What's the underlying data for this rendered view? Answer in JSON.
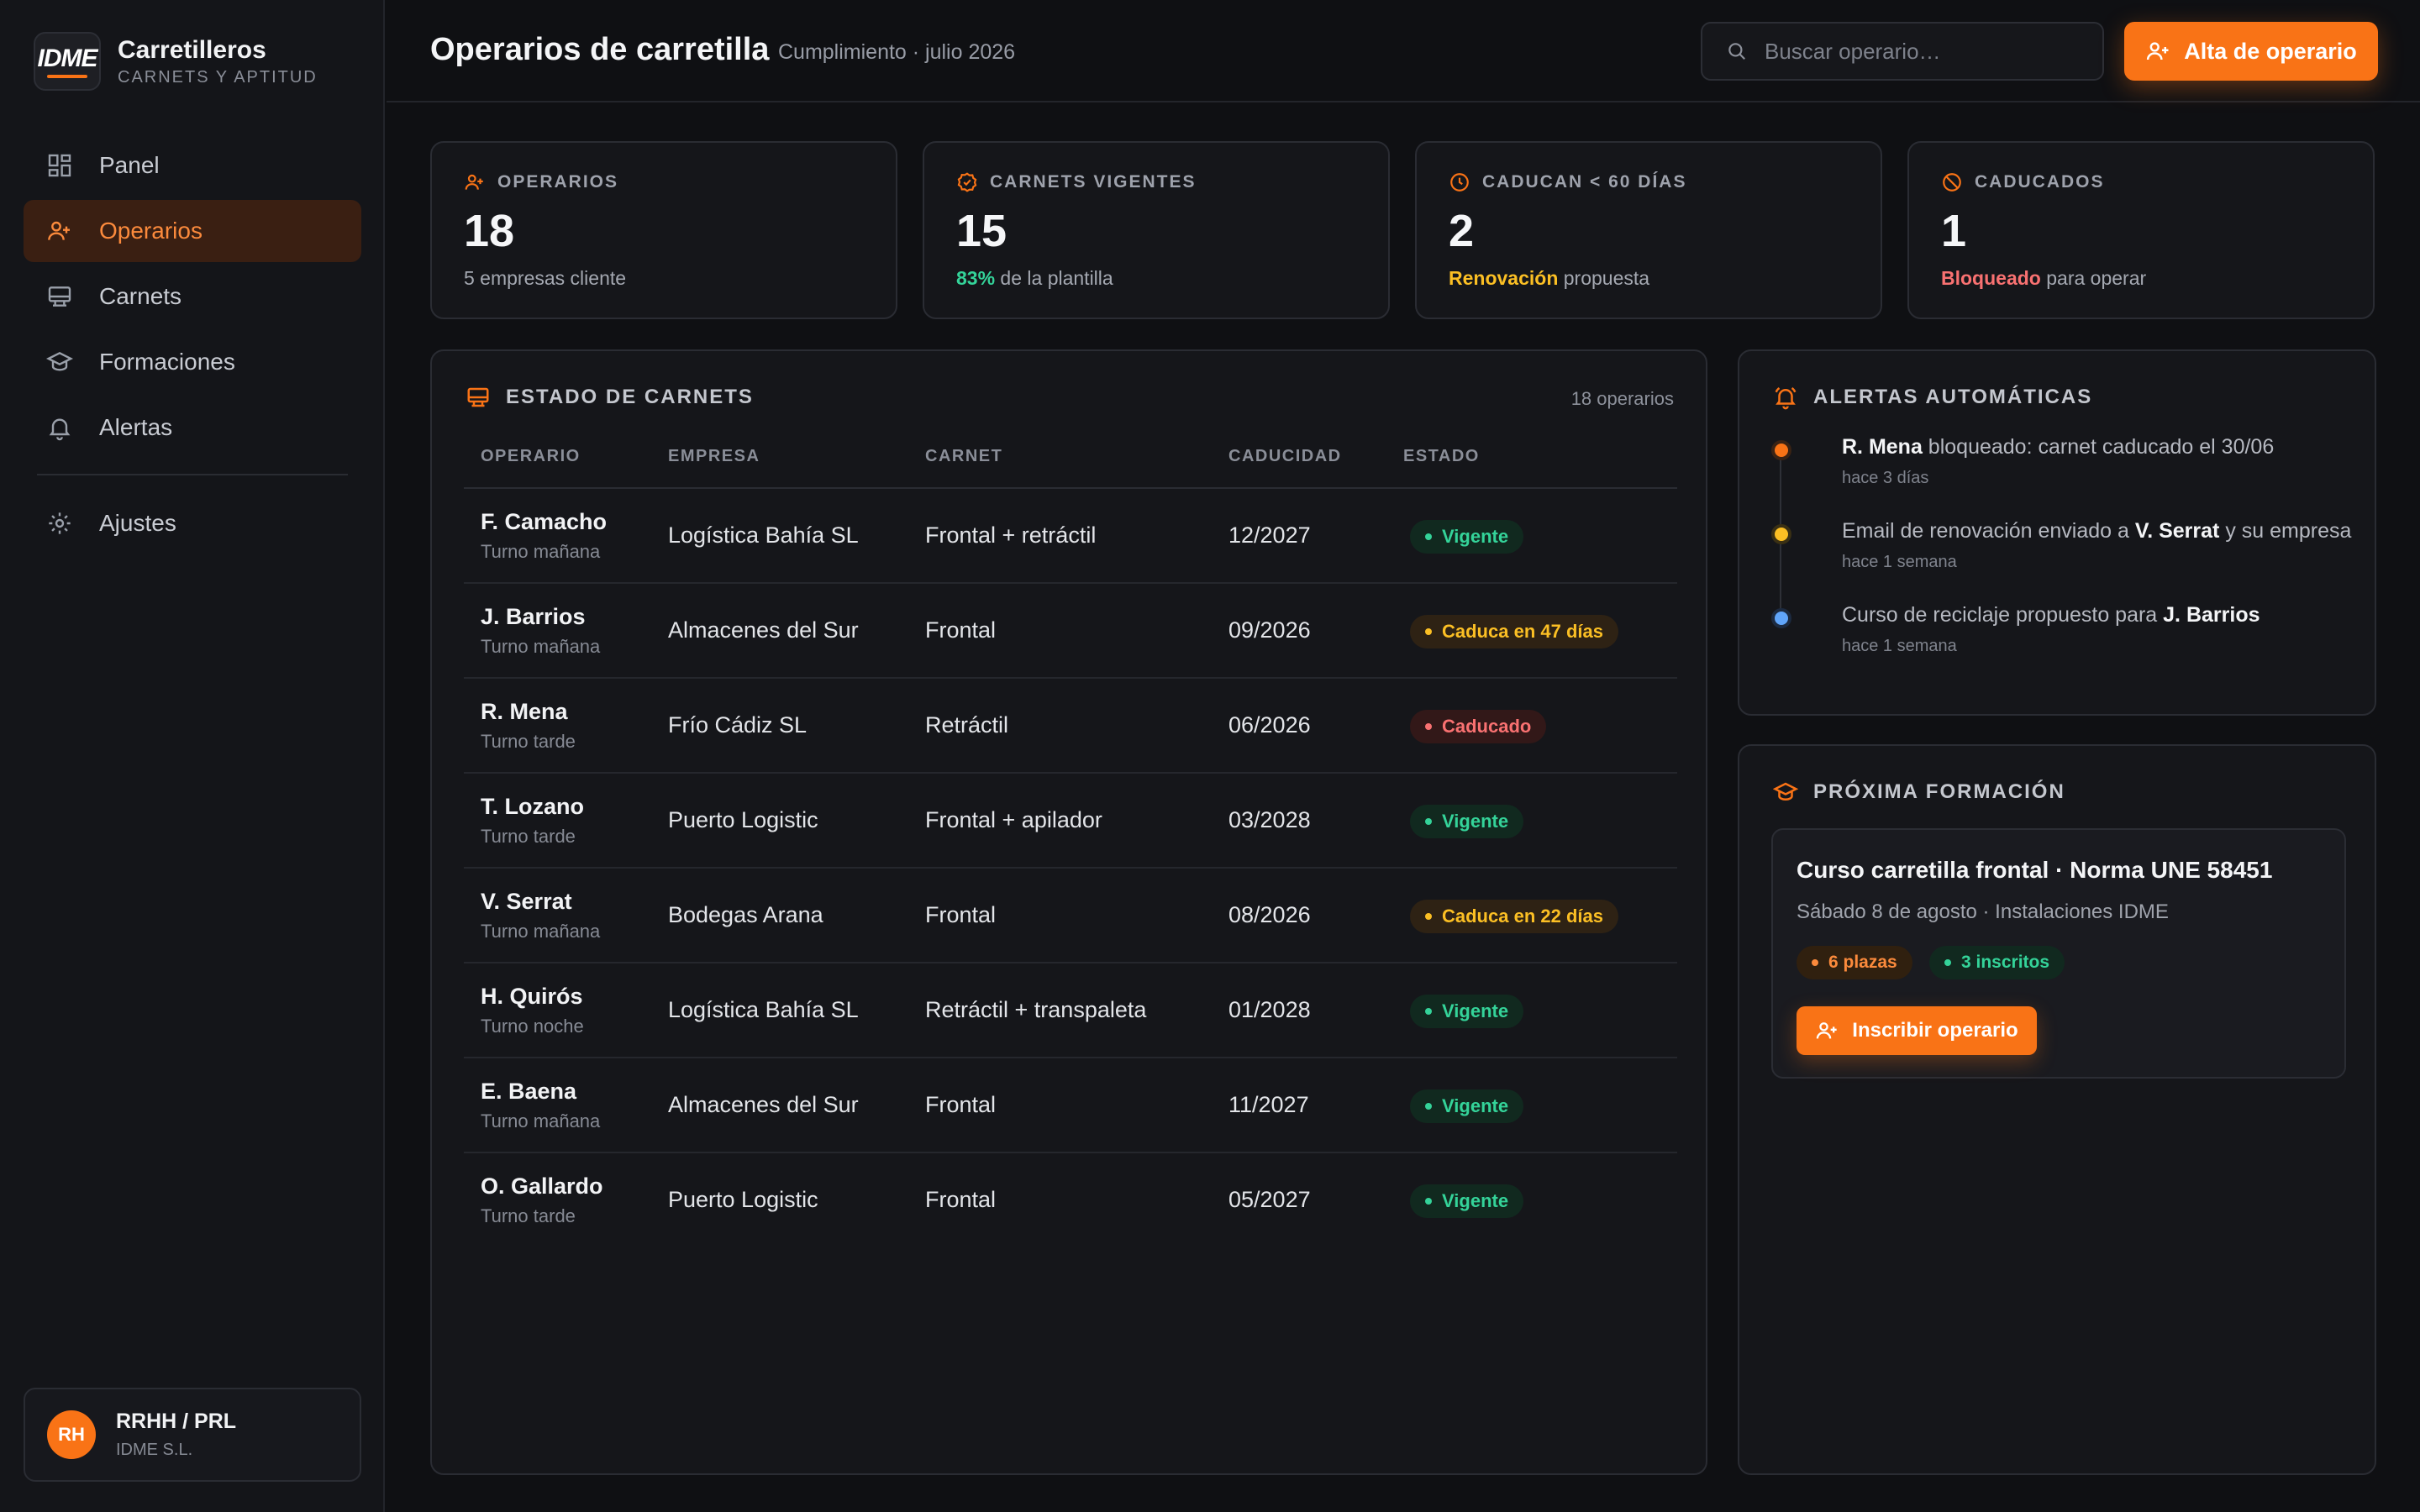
{
  "app": {
    "logo_text": "IDME",
    "title": "Carretilleros",
    "subtitle": "CARNETS Y APTITUD"
  },
  "sidebar": {
    "items": [
      {
        "label": "Panel",
        "icon": "dashboard-icon"
      },
      {
        "label": "Operarios",
        "icon": "users-icon",
        "active": true
      },
      {
        "label": "Carnets",
        "icon": "license-icon"
      },
      {
        "label": "Formaciones",
        "icon": "graduation-cap-icon"
      },
      {
        "label": "Alertas",
        "icon": "bell-icon"
      }
    ],
    "settings": {
      "label": "Ajustes",
      "icon": "gear-icon"
    }
  },
  "user": {
    "initials": "RH",
    "name": "RRHH / PRL",
    "org": "IDME S.L."
  },
  "header": {
    "title": "Operarios de carretilla",
    "subtitle": "Cumplimiento · julio 2026",
    "search_placeholder": "Buscar operario…",
    "primary_button": "Alta de operario"
  },
  "kpis": [
    {
      "label": "OPERARIOS",
      "value": "18",
      "note_strong": "",
      "note": "5 empresas cliente",
      "icon": "users-icon"
    },
    {
      "label": "CARNETS VIGENTES",
      "value": "15",
      "note_strong": "83%",
      "note": " de la plantilla",
      "icon": "badge-check-icon"
    },
    {
      "label": "CADUCAN < 60 DÍAS",
      "value": "2",
      "note_strong": "Renovación",
      "note": " propuesta",
      "icon": "clock-icon"
    },
    {
      "label": "CADUCADOS",
      "value": "1",
      "note_strong": "Bloqueado",
      "note": " para operar",
      "icon": "ban-icon"
    }
  ],
  "table": {
    "title": "ESTADO DE CARNETS",
    "count": "18 operarios",
    "columns": [
      "OPERARIO",
      "EMPRESA",
      "CARNET",
      "CADUCIDAD",
      "ESTADO"
    ],
    "rows": [
      {
        "name": "F. Camacho",
        "shift": "Turno mañana",
        "company": "Logística Bahía SL",
        "license": "Frontal + retráctil",
        "expiry": "12/2027",
        "status": "Vigente",
        "status_kind": "ok"
      },
      {
        "name": "J. Barrios",
        "shift": "Turno mañana",
        "company": "Almacenes del Sur",
        "license": "Frontal",
        "expiry": "09/2026",
        "status": "Caduca en 47 días",
        "status_kind": "warn"
      },
      {
        "name": "R. Mena",
        "shift": "Turno tarde",
        "company": "Frío Cádiz SL",
        "license": "Retráctil",
        "expiry": "06/2026",
        "status": "Caducado",
        "status_kind": "bad"
      },
      {
        "name": "T. Lozano",
        "shift": "Turno tarde",
        "company": "Puerto Logistic",
        "license": "Frontal + apilador",
        "expiry": "03/2028",
        "status": "Vigente",
        "status_kind": "ok"
      },
      {
        "name": "V. Serrat",
        "shift": "Turno mañana",
        "company": "Bodegas Arana",
        "license": "Frontal",
        "expiry": "08/2026",
        "status": "Caduca en 22 días",
        "status_kind": "warn"
      },
      {
        "name": "H. Quirós",
        "shift": "Turno noche",
        "company": "Logística Bahía SL",
        "license": "Retráctil + transpaleta",
        "expiry": "01/2028",
        "status": "Vigente",
        "status_kind": "ok"
      },
      {
        "name": "E. Baena",
        "shift": "Turno mañana",
        "company": "Almacenes del Sur",
        "license": "Frontal",
        "expiry": "11/2027",
        "status": "Vigente",
        "status_kind": "ok"
      },
      {
        "name": "O. Gallardo",
        "shift": "Turno tarde",
        "company": "Puerto Logistic",
        "license": "Frontal",
        "expiry": "05/2027",
        "status": "Vigente",
        "status_kind": "ok"
      }
    ]
  },
  "alerts": {
    "title": "ALERTAS AUTOMÁTICAS",
    "items": [
      {
        "pre": "",
        "strong": "R. Mena",
        "post": " bloqueado: carnet caducado el 30/06",
        "strong2": "",
        "post2": "",
        "time": "hace 3 días",
        "color": "#f97316"
      },
      {
        "pre": "Email de renovación enviado a ",
        "strong": "V. Serrat",
        "post": " y su empresa",
        "strong2": "",
        "post2": "",
        "time": "hace 1 semana",
        "color": "#fbbf24"
      },
      {
        "pre": "Curso de reciclaje propuesto para ",
        "strong": "J. Barrios",
        "post": "",
        "strong2": "",
        "post2": "",
        "time": "hace 1 semana",
        "color": "#60a5fa"
      }
    ]
  },
  "training": {
    "title": "PRÓXIMA FORMACIÓN",
    "course_title": "Curso carretilla frontal · Norma UNE 58451",
    "course_sub": "Sábado 8 de agosto · Instalaciones IDME",
    "seats": "6 plazas",
    "enrolled": "3 inscritos",
    "button": "Inscribir operario"
  },
  "colors": {
    "accent": "#f97316",
    "ok": "#34d399",
    "warn": "#fbbf24",
    "bad": "#f87171"
  }
}
